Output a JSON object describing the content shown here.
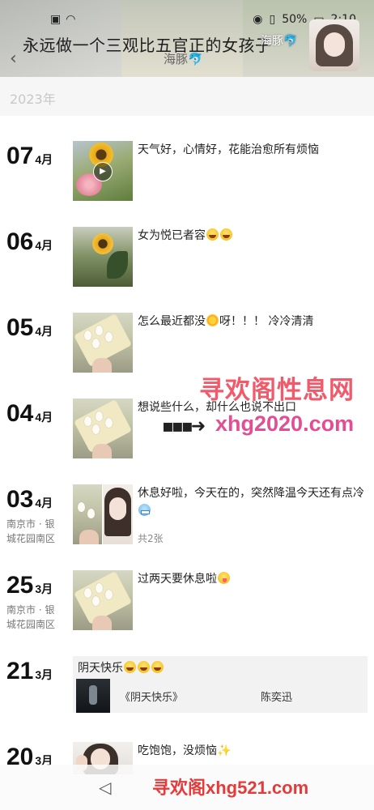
{
  "status": {
    "battery": "50%",
    "time": "2:10"
  },
  "header": {
    "signature": "永远做一个三观比五官正的女孩子",
    "title": "海豚🐬",
    "avatar_name": "海豚🐬"
  },
  "year": "2023年",
  "entries": [
    {
      "day": "07",
      "month": "4月",
      "text": "天气好，心情好，花能治愈所有烦恼",
      "has_video": true
    },
    {
      "day": "06",
      "month": "4月",
      "text_pre": "女为悦已者容",
      "emoji_count": 2
    },
    {
      "day": "05",
      "month": "4月",
      "text_pre": "怎么最近都没",
      "text_post": "呀！！！ 冷冷清清"
    },
    {
      "day": "04",
      "month": "4月",
      "text": "想说些什么，却什么也说不出口"
    },
    {
      "day": "03",
      "month": "4月",
      "location": "南京市 · 银城花园南区",
      "text_pre": "休息好啦，今天在的，突然降温今天还有点冷",
      "count": "共2张"
    },
    {
      "day": "25",
      "month": "3月",
      "location": "南京市 · 银城花园南区",
      "text_pre": "过两天要休息啦"
    },
    {
      "day": "21",
      "month": "3月",
      "music_title": "阴天快乐",
      "song": "《阴天快乐》",
      "artist": "陈奕迅"
    },
    {
      "day": "20",
      "month": "3月",
      "text_pre": "吃饱饱，没烦恼"
    }
  ],
  "watermarks": {
    "line1": "寻欢阁性息网",
    "line2": "xhg2020.com",
    "line3": "寻欢阁xhg521.com"
  },
  "icons": {
    "back": "chevron-left-icon",
    "play": "play-icon",
    "nav_back": "triangle-back-icon"
  }
}
